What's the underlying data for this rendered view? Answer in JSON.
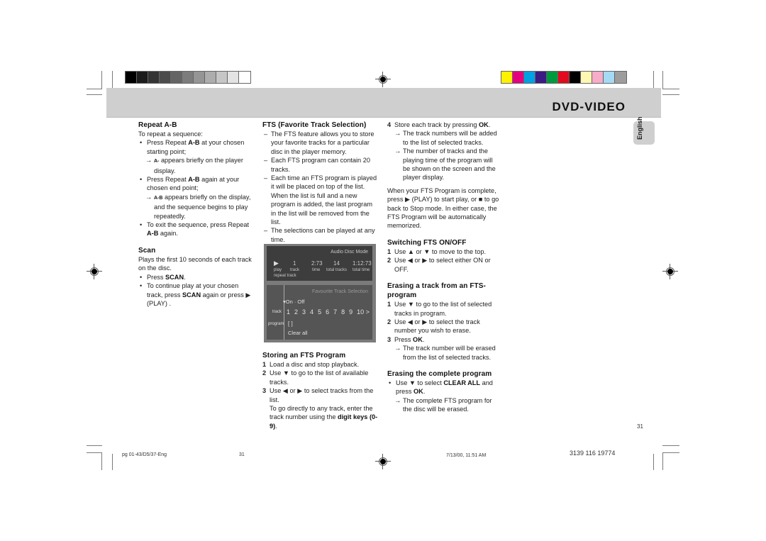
{
  "header": {
    "title": "DVD-VIDEO",
    "language_tab": "English",
    "gray_bar_colors": [
      "#000000",
      "#1c1c1c",
      "#343434",
      "#4c4c4c",
      "#646464",
      "#7c7c7c",
      "#959595",
      "#adadad",
      "#c6c6c6",
      "#e3e3e3",
      "#ffffff"
    ],
    "color_bar_colors": [
      "#fff200",
      "#e6007e",
      "#00a0e3",
      "#3b1c84",
      "#009a3e",
      "#e20a1e",
      "#000000",
      "#fff7b2",
      "#f7acc8",
      "#a5daf5",
      "#9d9d9d"
    ]
  },
  "col1": {
    "repeat_title": "Repeat A-B",
    "repeat_intro": "To repeat a sequence:",
    "repeat_items": [
      {
        "pre": "Press Repeat ",
        "bold": "A-B",
        "post": " at your chosen starting point;"
      },
      {
        "sub": true,
        "bold": "A-",
        "post": " appears briefly on the player display."
      },
      {
        "pre": "Press Repeat ",
        "bold": "A-B",
        "post": " again at your chosen end point;"
      },
      {
        "sub": true,
        "bold": "A-B",
        "post": " appears briefly on the display, and the sequence begins to play repeatedly."
      },
      {
        "pre": "To exit the sequence, press Repeat ",
        "bold": "A-B",
        "post": " again."
      }
    ],
    "scan_title": "Scan",
    "scan_intro": "Plays the first 10 seconds of each track on the disc.",
    "scan_items": [
      {
        "pre": "Press ",
        "bold": "SCAN",
        "post": "."
      },
      {
        "pre": "To continue play at your chosen track, press ",
        "bold": "SCAN",
        "post": " again or press ▶ (PLAY) ."
      }
    ]
  },
  "col2": {
    "fts_title": "FTS (Favorite Track Selection)",
    "fts_items": [
      "The FTS feature allows you to store your favorite tracks for a particular disc in the player memory.",
      "Each FTS program can contain 20 tracks.",
      "Each time an FTS program is played it will be placed on top of the list. When the list is full and a new program is added, the last program in the list will be removed from the list.",
      "The selections can be played at any time."
    ],
    "screen": {
      "mode": "Audio Disc Mode",
      "values": [
        "▶",
        "1",
        "2:73",
        "14",
        "1:12:73"
      ],
      "labels": [
        "play",
        "track",
        "time",
        "total tracks",
        "total time"
      ],
      "sub_label": "repeat track",
      "fts_heading": "Favourite Track Selection",
      "on_off": "On · Off",
      "track_label": "track",
      "tracks": [
        "1",
        "2",
        "3",
        "4",
        "5",
        "6",
        "7",
        "8",
        "9",
        "10 >"
      ],
      "program_label": "program",
      "program_value": "[ ]",
      "clear_all": "Clear all"
    },
    "storing_title": "Storing an FTS Program",
    "storing_steps": [
      {
        "n": "1",
        "text": "Load a disc and stop playback."
      },
      {
        "n": "2",
        "text": "Use ▼ to go to the list of available tracks."
      },
      {
        "n": "3",
        "text": "Use ◀ or ▶ to select tracks from the list."
      }
    ],
    "storing_note_pre": "To go directly to any track, enter the track number using the ",
    "storing_note_bold": "digit keys (0-9)",
    "storing_note_post": "."
  },
  "col3": {
    "step4_n": "4",
    "step4_pre": "Store each track by pressing ",
    "step4_bold": "OK",
    "step4_post": ".",
    "step4_subs": [
      "The track numbers will be added to the list of selected tracks.",
      "The number of tracks and the playing time of the program will be shown on the screen and the player display."
    ],
    "complete_text": "When your FTS Program is complete, press ▶ (PLAY) to start play, or ■ to go back to Stop mode. In either case, the FTS Program will be automatically memorized.",
    "switch_title": "Switching FTS ON/OFF",
    "switch_steps": [
      {
        "n": "1",
        "text": "Use ▲ or ▼ to move to the top."
      },
      {
        "n": "2",
        "text": "Use ◀ or ▶ to select either ON or OFF."
      }
    ],
    "erase_track_title": "Erasing a track from an FTS-program",
    "erase_track_steps": [
      {
        "n": "1",
        "text": "Use ▼ to go to the list of selected tracks in program."
      },
      {
        "n": "2",
        "text": "Use ◀ or ▶ to select the track number you wish to erase."
      },
      {
        "n": "3",
        "pre": "Press ",
        "bold": "OK",
        "post": "."
      }
    ],
    "erase_track_sub": "The track number will be erased from the list of selected tracks.",
    "erase_all_title": "Erasing the complete program",
    "erase_all_pre": "Use ▼ to select ",
    "erase_all_bold1": "CLEAR ALL",
    "erase_all_mid": " and press ",
    "erase_all_bold2": "OK",
    "erase_all_post": ".",
    "erase_all_sub": "The complete FTS program for the disc will be erased."
  },
  "page_number": "31",
  "footer": {
    "file": "pg 01-43/D5/37-Eng",
    "page": "31",
    "date": "7/13/00, 11:51 AM",
    "code": "3139 116 19774"
  }
}
